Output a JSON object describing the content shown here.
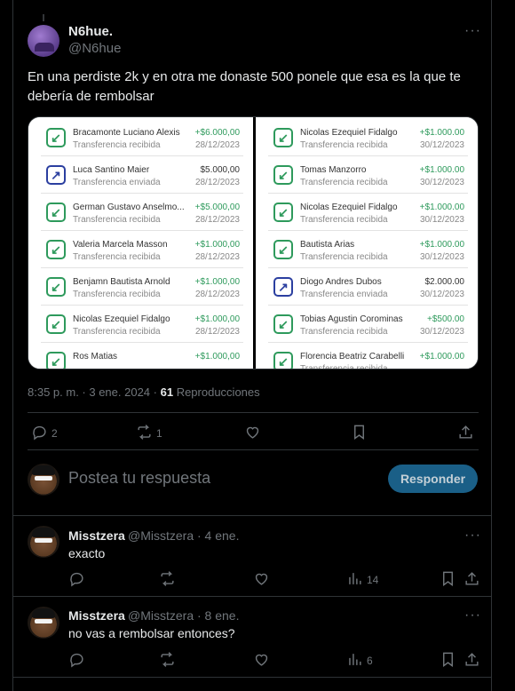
{
  "post": {
    "display_name": "N6hue.",
    "handle": "@N6hue",
    "text": "En una perdiste 2k y en otra me donaste 500 ponele que esa es la que te debería de rembolsar",
    "time": "8:35 p. m. · 3 ene. 2024 · ",
    "views_count": "61",
    "views_label": "Reproducciones",
    "replies_count": "2",
    "reposts_count": "1"
  },
  "media": {
    "left": [
      {
        "name": "Bracamonte Luciano Alexis",
        "type": "Transferencia recibida",
        "amount": "+$6.000,00",
        "date": "28/12/2023",
        "dir": "in"
      },
      {
        "name": "Luca Santino Maier",
        "type": "Transferencia enviada",
        "amount": "$5.000,00",
        "date": "28/12/2023",
        "dir": "out"
      },
      {
        "name": "German Gustavo Anselmo...",
        "type": "Transferencia recibida",
        "amount": "+$5.000,00",
        "date": "28/12/2023",
        "dir": "in"
      },
      {
        "name": "Valeria Marcela Masson",
        "type": "Transferencia recibida",
        "amount": "+$1.000,00",
        "date": "28/12/2023",
        "dir": "in"
      },
      {
        "name": "Benjamn Bautista Arnold",
        "type": "Transferencia recibida",
        "amount": "+$1.000,00",
        "date": "28/12/2023",
        "dir": "in"
      },
      {
        "name": "Nicolas Ezequiel Fidalgo",
        "type": "Transferencia recibida",
        "amount": "+$1.000,00",
        "date": "28/12/2023",
        "dir": "in"
      },
      {
        "name": "Ros Matias",
        "type": "",
        "amount": "+$1.000,00",
        "date": "",
        "dir": "in"
      }
    ],
    "right": [
      {
        "name": "Nicolas Ezequiel Fidalgo",
        "type": "Transferencia recibida",
        "amount": "+$1.000.00",
        "date": "30/12/2023",
        "dir": "in"
      },
      {
        "name": "Tomas Manzorro",
        "type": "Transferencia recibida",
        "amount": "+$1.000.00",
        "date": "30/12/2023",
        "dir": "in"
      },
      {
        "name": "Nicolas Ezequiel Fidalgo",
        "type": "Transferencia recibida",
        "amount": "+$1.000.00",
        "date": "30/12/2023",
        "dir": "in"
      },
      {
        "name": "Bautista Arias",
        "type": "Transferencia recibida",
        "amount": "+$1.000.00",
        "date": "30/12/2023",
        "dir": "in"
      },
      {
        "name": "Diogo Andres Dubos",
        "type": "Transferencia enviada",
        "amount": "$2.000.00",
        "date": "30/12/2023",
        "dir": "out"
      },
      {
        "name": "Tobias Agustin Corominas",
        "type": "Transferencia recibida",
        "amount": "+$500.00",
        "date": "30/12/2023",
        "dir": "in"
      },
      {
        "name": "Florencia Beatriz Carabelli",
        "type": "Transferencia recibida",
        "amount": "+$1.000.00",
        "date": "",
        "dir": "in"
      }
    ]
  },
  "composer": {
    "placeholder": "Postea tu respuesta",
    "button": "Responder"
  },
  "replies": [
    {
      "display_name": "Misstzera",
      "handle": "@Misstzera · 4 ene.",
      "text": "exacto",
      "views": "14"
    },
    {
      "display_name": "Misstzera",
      "handle": "@Misstzera · 8 ene.",
      "text": "no vas a rembolsar entonces?",
      "views": "6"
    }
  ],
  "icons": [
    "more-icon",
    "reply-icon",
    "repost-icon",
    "like-icon",
    "bookmark-icon",
    "share-icon",
    "views-icon",
    "arrow-in-icon",
    "arrow-out-icon"
  ],
  "colors": {
    "accent": "#1d6a96",
    "green": "#2e9a5c",
    "blue_out": "#2b3fa0"
  }
}
